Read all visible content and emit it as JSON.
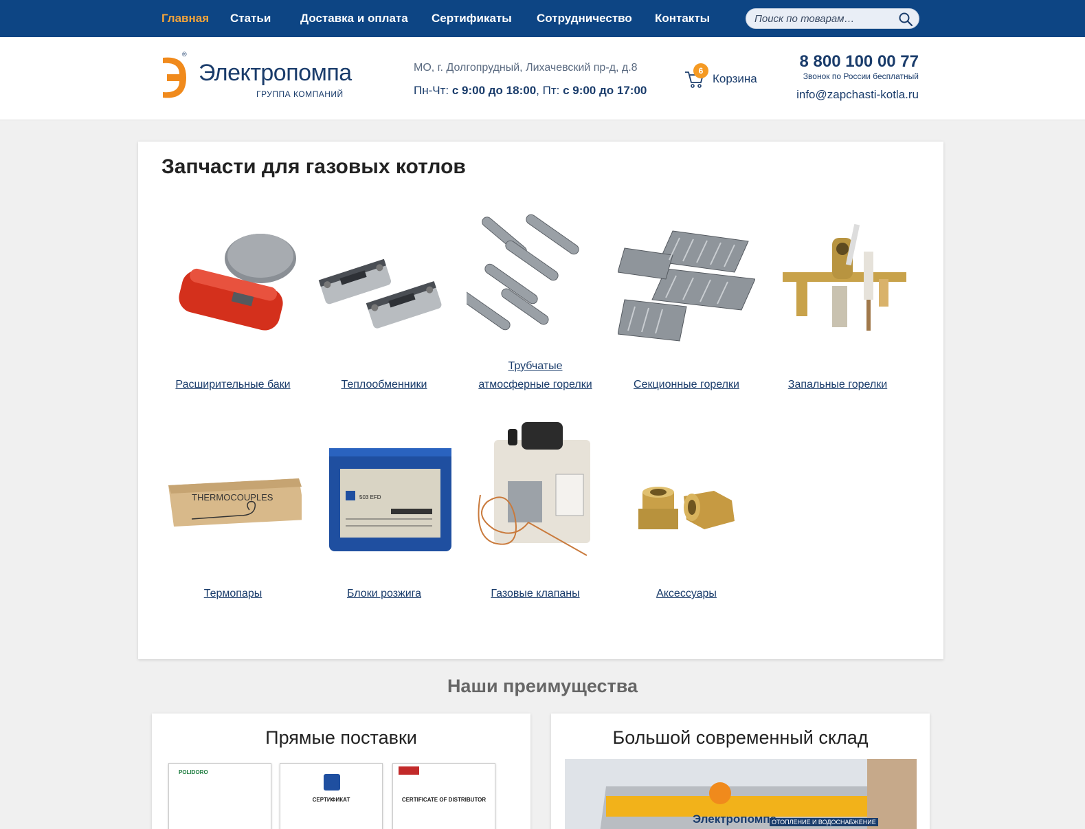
{
  "nav": {
    "items": [
      {
        "label": "Главная",
        "active": true
      },
      {
        "label": "Статьи"
      },
      {
        "label": "Доставка и оплата"
      },
      {
        "label": "Сертификаты"
      },
      {
        "label": "Сотрудничество"
      },
      {
        "label": "Контакты"
      }
    ],
    "search_placeholder": "Поиск по товарам…"
  },
  "header": {
    "logo_brand": "Электропомпа",
    "logo_sub": "ГРУППА КОМПАНИЙ",
    "logo_reg": "®",
    "address": "МО, г. Долгопрудный, Лихачевский пр-д, д.8",
    "hours_weekdays_prefix": "Пн-Чт: ",
    "hours_weekdays": "с 9:00 до 18:00",
    "hours_friday_prefix": ", Пт: ",
    "hours_friday": "с 9:00 до 17:00",
    "cart_label": "Корзина",
    "cart_count": "6",
    "phone": "8 800 100 00 77",
    "phone_note": "Звонок по России бесплатный",
    "email": "info@zapchasti-kotla.ru"
  },
  "catalog": {
    "title": "Запчасти для газовых котлов",
    "items": [
      {
        "label": "Расширительные баки",
        "icon": "expansion-tank-image"
      },
      {
        "label": "Теплообменники",
        "icon": "heat-exchanger-image"
      },
      {
        "label_line1": "Трубчатые",
        "label_line2": "атмосферные горелки",
        "icon": "tubular-burner-image"
      },
      {
        "label": "Секционные горелки",
        "icon": "sectional-burner-image"
      },
      {
        "label": "Запальные горелки",
        "icon": "pilot-burner-image"
      },
      {
        "label": "Термопары",
        "icon": "thermocouple-image"
      },
      {
        "label": "Блоки розжига",
        "icon": "ignition-unit-image"
      },
      {
        "label": "Газовые клапаны",
        "icon": "gas-valve-image"
      },
      {
        "label": "Аксессуары",
        "icon": "accessories-image"
      }
    ]
  },
  "advantages": {
    "title": "Наши преимущества",
    "cards": [
      {
        "title": "Прямые поставки",
        "docs": [
          "POLIDORO",
          "СЕРТИФИКАТ",
          "CERTIFICATE OF DISTRIBUTOR"
        ]
      },
      {
        "title": "Большой современный склад",
        "sign_brand": "Электропомпа",
        "sign_text": "ОТОПЛЕНИЕ И ВОДОСНАБЖЕНИЕ"
      }
    ]
  },
  "colors": {
    "nav_bg": "#0d4584",
    "nav_active": "#f5a53a",
    "brand_blue": "#1a3c6b",
    "accent_orange": "#f59a23"
  }
}
